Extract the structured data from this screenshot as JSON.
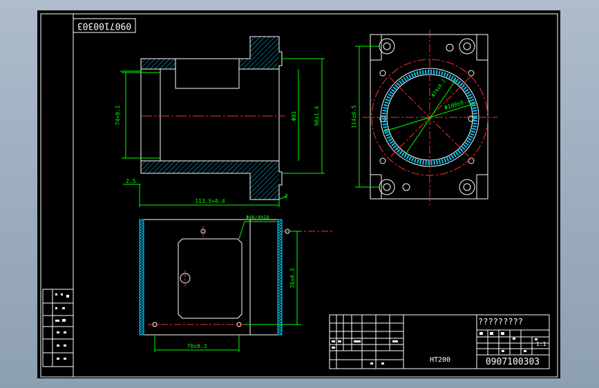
{
  "drawing_code_rotated": "0907100303",
  "title_block": {
    "drawing_name": "?????????",
    "scale": "1:1",
    "material": "HT200",
    "drawing_code": "0907100303"
  },
  "dimensions": {
    "left_bore": "74+0.1",
    "center_dia": "Φ81",
    "outer_height": "96±1.4",
    "wall_offset": "2.5",
    "overall_length": "113.5+0.4",
    "flange_gap": "2",
    "hole_dia": "Φ40/4h10",
    "vertical_76": "76±0.3",
    "horizontal_70": "70±0.3",
    "right_height": "114±0.5",
    "circle_dia": "Φ100±0.2",
    "inner_dia": "Φ74±0.2"
  },
  "colors": {
    "background": "#000000",
    "outline": "#ffffff",
    "center_line": "#ff3030",
    "dimension": "#00ff00",
    "hatch": "#00c8ff"
  }
}
